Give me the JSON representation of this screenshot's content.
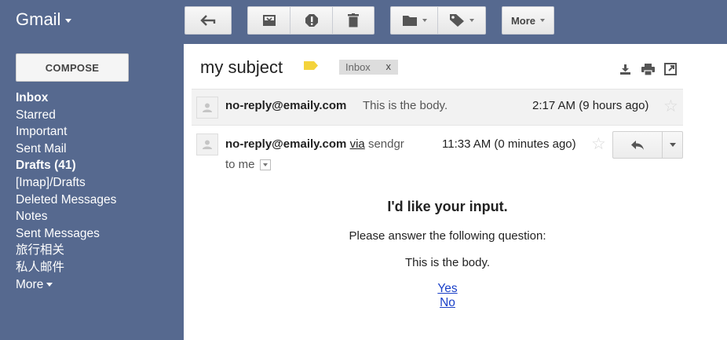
{
  "app": {
    "name": "Gmail"
  },
  "toolbar": {
    "back_icon": "back-arrow-icon",
    "archive_icon": "archive-icon",
    "spam_icon": "report-spam-icon",
    "delete_icon": "trash-icon",
    "move_icon": "folder-icon",
    "labels_icon": "label-tag-icon",
    "more_label": "More"
  },
  "sidebar": {
    "compose_label": "COMPOSE",
    "items": [
      {
        "label": "Inbox",
        "bold": true
      },
      {
        "label": "Starred",
        "bold": false
      },
      {
        "label": "Important",
        "bold": false
      },
      {
        "label": "Sent Mail",
        "bold": false
      },
      {
        "label": "Drafts (41)",
        "bold": true
      },
      {
        "label": "[Imap]/Drafts",
        "bold": false
      },
      {
        "label": "Deleted Messages",
        "bold": false
      },
      {
        "label": "Notes",
        "bold": false
      },
      {
        "label": "Sent Messages",
        "bold": false
      },
      {
        "label": "旅行相关",
        "bold": false
      },
      {
        "label": "私人邮件",
        "bold": false
      }
    ],
    "more_label": "More"
  },
  "thread": {
    "subject": "my subject",
    "label_chip": "Inbox",
    "label_remove": "x",
    "importance_color": "#f4d33b"
  },
  "messages": [
    {
      "sender": "no-reply@emaily.com",
      "snippet": "This is the body.",
      "time": "2:17 AM (9 hours ago)"
    },
    {
      "sender": "no-reply@emaily.com",
      "via_label": "via",
      "via_domain": "sendgr",
      "time": "11:33 AM (0 minutes ago)",
      "recipient": "to me"
    }
  ],
  "email_body": {
    "heading": "I'd like your input.",
    "prompt": "Please answer the following question:",
    "question": "This is the body.",
    "option_yes": "Yes",
    "option_no": "No"
  },
  "colors": {
    "chrome": "#56698f",
    "link": "#1a40c8"
  }
}
